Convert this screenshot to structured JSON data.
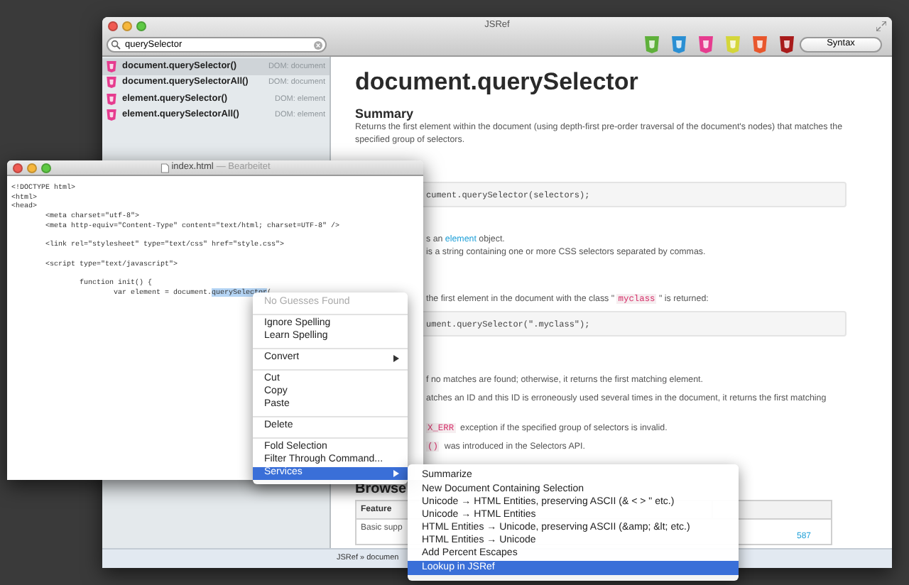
{
  "jsref_window": {
    "title": "JSRef",
    "search": {
      "value": "querySelector"
    },
    "toolbar_badges": [
      {
        "color": "#5fb03b"
      },
      {
        "color": "#2a8fd3"
      },
      {
        "color": "#e63c8f"
      },
      {
        "color": "#d4d63a"
      },
      {
        "color": "#e8562c"
      },
      {
        "color": "#a81b1b"
      }
    ],
    "syntax_button": "Syntax",
    "results": [
      {
        "name": "document.querySelector()",
        "category": "DOM: document",
        "selected": true
      },
      {
        "name": "document.querySelectorAll()",
        "category": "DOM: document",
        "selected": false
      },
      {
        "name": "element.querySelector()",
        "category": "DOM: element",
        "selected": false
      },
      {
        "name": "element.querySelectorAll()",
        "category": "DOM: element",
        "selected": false
      }
    ],
    "article": {
      "title": "document.querySelector",
      "summary_heading": "Summary",
      "summary": "Returns the first element within the document (using depth-first pre-order traversal of the document's nodes) that matches the specified group of selectors.",
      "blocks": [
        {
          "kind": "code",
          "parts": [
            {
              "kind": "text",
              "text": "cument.querySelector(selectors);"
            }
          ]
        },
        {
          "kind": "line",
          "parts": [
            {
              "kind": "text",
              "text": "s an "
            },
            {
              "kind": "link",
              "text": "element"
            },
            {
              "kind": "text",
              "text": " object."
            }
          ]
        },
        {
          "kind": "line",
          "parts": [
            {
              "kind": "text",
              "text": "is a string containing one or more CSS selectors separated by commas."
            }
          ]
        },
        {
          "kind": "line",
          "parts": [
            {
              "kind": "text",
              "text": "the first element in the document with the class \" "
            },
            {
              "kind": "code",
              "text": "myclass"
            },
            {
              "kind": "text",
              "text": " \" is returned:"
            }
          ]
        },
        {
          "kind": "code",
          "parts": [
            {
              "kind": "text",
              "text": "ument.querySelector(\".myclass\");"
            }
          ]
        },
        {
          "kind": "line",
          "parts": [
            {
              "kind": "text",
              "text": "f no matches are found; otherwise, it returns the first matching element."
            }
          ]
        },
        {
          "kind": "line",
          "parts": [
            {
              "kind": "text",
              "text": "atches an ID and this ID is erroneously used several times in the document, it returns the first matching"
            }
          ]
        },
        {
          "kind": "line",
          "parts": [
            {
              "kind": "code",
              "text": "X_ERR"
            },
            {
              "kind": "text",
              "text": "  exception if the specified group of selectors is invalid."
            }
          ]
        },
        {
          "kind": "line",
          "parts": [
            {
              "kind": "code",
              "text": "()"
            },
            {
              "kind": "text",
              "text": "  was introduced in the Selectors API."
            }
          ]
        }
      ],
      "section_heading": "Browse",
      "table": {
        "column_1": "Feature",
        "cell": "Basic supp",
        "link": "587"
      }
    },
    "status_bar": "JSRef » documen"
  },
  "editor_window": {
    "title": "index.html",
    "status": "— Bearbeitet",
    "code_lines": [
      {
        "kind": "code",
        "text": "<!DOCTYPE html>"
      },
      {
        "kind": "code",
        "text": "<html>"
      },
      {
        "kind": "code",
        "text": "<head>"
      },
      {
        "kind": "code",
        "text": "        <meta charset=\"utf-8\">"
      },
      {
        "kind": "code",
        "text": "        <meta http-equiv=\"Content-Type\" content=\"text/html; charset=UTF-8\" />"
      },
      {
        "kind": "blank"
      },
      {
        "kind": "code",
        "text": "        <link rel=\"stylesheet\" type=\"text/css\" href=\"style.css\">"
      },
      {
        "kind": "blank"
      },
      {
        "kind": "code",
        "text": "        <script type=\"text/javascript\">"
      },
      {
        "kind": "blank"
      },
      {
        "kind": "code",
        "text": "                function init() {"
      },
      {
        "kind": "code",
        "text": "                        var element = document.",
        "selection": "querySelector",
        "after": "("
      }
    ]
  },
  "context_menu": {
    "groups": [
      [
        {
          "label": "No Guesses Found",
          "kind": "item",
          "disabled": true,
          "selected": false
        }
      ],
      [
        {
          "label": "Ignore Spelling",
          "kind": "item",
          "disabled": false,
          "selected": false
        },
        {
          "label": "Learn Spelling",
          "kind": "item",
          "disabled": false,
          "selected": false
        }
      ],
      [
        {
          "label": "Convert",
          "kind": "submenu",
          "disabled": false,
          "selected": false
        }
      ],
      [
        {
          "label": "Cut",
          "kind": "item",
          "disabled": false,
          "selected": false
        },
        {
          "label": "Copy",
          "kind": "item",
          "disabled": false,
          "selected": false
        },
        {
          "label": "Paste",
          "kind": "item",
          "disabled": false,
          "selected": false
        }
      ],
      [
        {
          "label": "Delete",
          "kind": "item",
          "disabled": false,
          "selected": false
        }
      ],
      [
        {
          "label": "Fold Selection",
          "kind": "item",
          "disabled": false,
          "selected": false
        },
        {
          "label": "Filter Through Command...",
          "kind": "item",
          "disabled": false,
          "selected": false
        },
        {
          "label": "Services",
          "kind": "submenu",
          "disabled": false,
          "selected": true
        }
      ]
    ]
  },
  "services_menu": {
    "items": [
      {
        "label": "Summarize",
        "selected": false
      },
      {
        "label": "New Document Containing Selection",
        "selected": false
      },
      {
        "label": "Unicode → HTML Entities, preserving ASCII (& < > \" etc.)",
        "selected": false
      },
      {
        "label": "Unicode → HTML Entities",
        "selected": false
      },
      {
        "label": "HTML Entities → Unicode, preserving ASCII (&amp; &lt; etc.)",
        "selected": false
      },
      {
        "label": "HTML Entities → Unicode",
        "selected": false
      },
      {
        "label": "Add Percent Escapes",
        "selected": false
      },
      {
        "label": "Lookup in JSRef",
        "selected": true
      }
    ]
  }
}
